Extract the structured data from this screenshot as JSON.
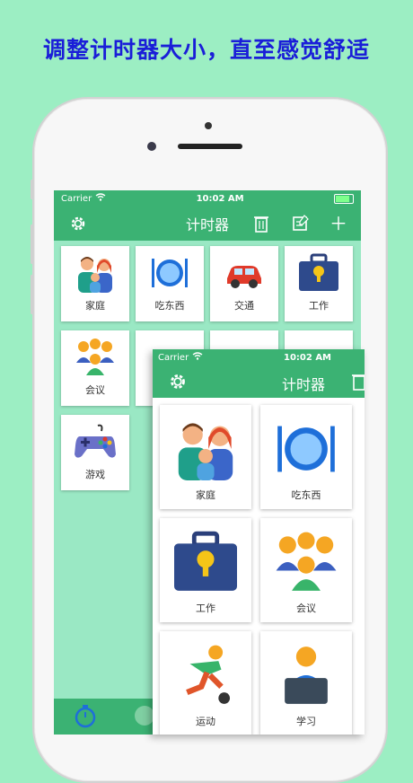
{
  "headline": "调整计时器大小，直至感觉舒适",
  "status": {
    "carrier": "Carrier",
    "time": "10:02 AM"
  },
  "app": {
    "title": "计时器"
  },
  "tiles": [
    {
      "label": "家庭",
      "icon": "family-icon"
    },
    {
      "label": "吃东西",
      "icon": "plate-cutlery-icon"
    },
    {
      "label": "交通",
      "icon": "car-icon"
    },
    {
      "label": "工作",
      "icon": "briefcase-icon"
    },
    {
      "label": "会议",
      "icon": "meeting-people-icon"
    },
    {
      "label": "",
      "icon": "person-icon"
    },
    {
      "label": "",
      "icon": "running-icon"
    },
    {
      "label": "",
      "icon": "study-icon"
    },
    {
      "label": "游戏",
      "icon": "gamepad-icon"
    }
  ],
  "overlay": {
    "carrier": "Carrier",
    "time": "10:02 AM",
    "title": "计时器",
    "tiles": [
      {
        "label": "家庭",
        "icon": "family-icon"
      },
      {
        "label": "吃东西",
        "icon": "plate-cutlery-icon"
      },
      {
        "label": "工作",
        "icon": "briefcase-icon"
      },
      {
        "label": "会议",
        "icon": "meeting-people-icon"
      },
      {
        "label": "运动",
        "icon": "soccer-player-icon"
      },
      {
        "label": "学习",
        "icon": "study-icon"
      }
    ]
  },
  "colors": {
    "background": "#9ceec3",
    "headline": "#1a1ed8",
    "bar": "#3bb273"
  }
}
